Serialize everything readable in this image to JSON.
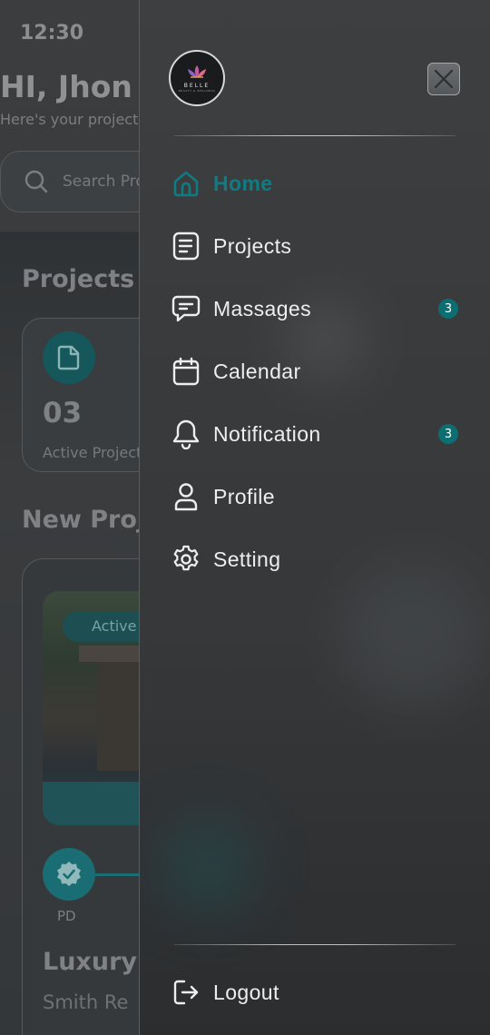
{
  "status_bar": {
    "time": "12:30"
  },
  "background": {
    "greeting": "HI, Jhon",
    "subtitle": "Here's your projects",
    "search_placeholder": "Search Projects",
    "projects_title": "Projects",
    "active_projects_count": "03",
    "active_projects_label": "Active Projects",
    "new_projects_title": "New Projects",
    "status_badge": "Active",
    "step_label": "PD",
    "card_title": "Luxury",
    "card_subtitle": "Smith Re"
  },
  "drawer": {
    "logo_text": "BELLE",
    "logo_subtext": "BEAUTY & WELLNESS",
    "menu": [
      {
        "label": "Home",
        "icon": "home-icon",
        "active": true
      },
      {
        "label": "Projects",
        "icon": "document-icon"
      },
      {
        "label": "Massages",
        "icon": "chat-icon",
        "badge": "3"
      },
      {
        "label": "Calendar",
        "icon": "calendar-icon"
      },
      {
        "label": "Notification",
        "icon": "bell-icon",
        "badge": "3"
      },
      {
        "label": "Profile",
        "icon": "user-icon"
      },
      {
        "label": "Setting",
        "icon": "gear-icon"
      }
    ],
    "logout_label": "Logout"
  },
  "colors": {
    "accent": "#0e7c82",
    "badge_bg": "#0d6e72",
    "text": "#eeeeee"
  }
}
